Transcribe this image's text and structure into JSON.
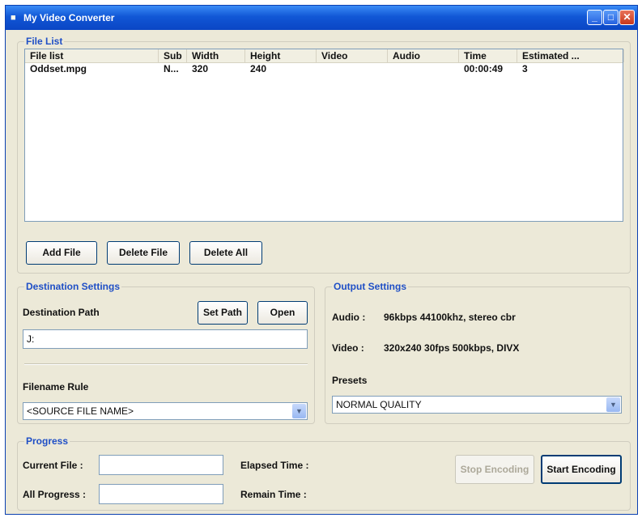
{
  "window": {
    "title": "My Video Converter"
  },
  "file_list": {
    "group_title": "File List",
    "columns": [
      "File list",
      "Sub",
      "Width",
      "Height",
      "Video",
      "Audio",
      "Time",
      "Estimated ..."
    ],
    "rows": [
      [
        "Oddset.mpg",
        "N...",
        "320",
        "240",
        "",
        "",
        "00:00:49",
        "3"
      ]
    ],
    "buttons": {
      "add": "Add File",
      "delete": "Delete File",
      "delete_all": "Delete All"
    }
  },
  "destination": {
    "group_title": "Destination Settings",
    "path_label": "Destination Path",
    "set_path": "Set Path",
    "open": "Open",
    "path_value": "J:",
    "filename_rule_label": "Filename Rule",
    "filename_rule_value": "<SOURCE FILE NAME>"
  },
  "output": {
    "group_title": "Output Settings",
    "audio_label": "Audio :",
    "audio_value": "96kbps 44100khz, stereo cbr",
    "video_label": "Video :",
    "video_value": "320x240 30fps 500kbps, DIVX",
    "presets_label": "Presets",
    "presets_value": "NORMAL QUALITY"
  },
  "progress": {
    "group_title": "Progress",
    "current_file_label": "Current File :",
    "all_progress_label": "All Progress :",
    "elapsed_label": "Elapsed Time :",
    "remain_label": "Remain Time :",
    "stop": "Stop Encoding",
    "start": "Start Encoding"
  },
  "icons": {
    "app": "video-app-icon",
    "minimize": "minimize-icon",
    "maximize": "maximize-icon",
    "close": "close-icon",
    "dropdown": "chevron-down-icon"
  },
  "colors": {
    "titlebar": "#1157d6",
    "group_title": "#1f4fc6",
    "window_bg": "#ece9d8"
  }
}
